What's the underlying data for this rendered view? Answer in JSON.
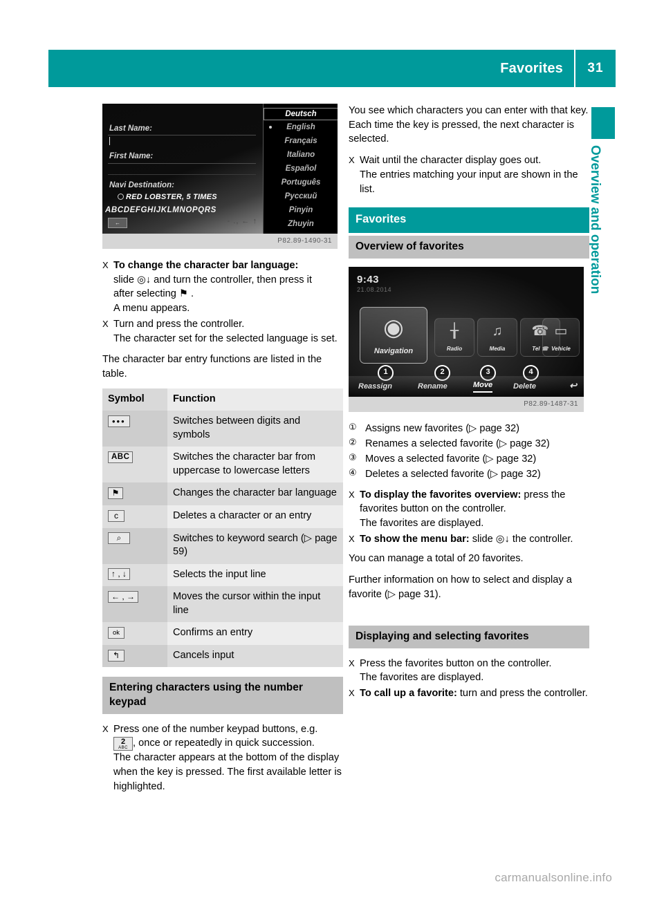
{
  "header": {
    "title": "Favorites",
    "page_number": "31"
  },
  "side_tab": {
    "label": "Overview and operation"
  },
  "footer": {
    "watermark": "carmanualsonline.info"
  },
  "figure_character_entry": {
    "code": "P82.89-1490-31",
    "field_last_name": "Last Name:",
    "field_first_name": "First Name:",
    "field_navi_destination": "Navi Destination:",
    "destination_value": "RED LOBSTER, 5 TIMES",
    "character_bar": "ABCDEFGHIJKLMNOPQRS",
    "back_key": "←",
    "small_glyphs": "- ., ← ↑",
    "languages": [
      "Deutsch",
      "English",
      "Français",
      "Italiano",
      "Español",
      "Português",
      "Русский",
      "Pinyin",
      "Zhuyin"
    ],
    "selected_language": "Deutsch",
    "active_language": "English"
  },
  "figure_favorites": {
    "code": "P82.89-1487-31",
    "time": "9:43",
    "date": "21.08.2014",
    "tiles": [
      {
        "label": "Navigation",
        "glyph": "◉"
      },
      {
        "label": "Radio",
        "glyph": "╁"
      },
      {
        "label": "Media",
        "glyph": "♫"
      },
      {
        "label": "Tel ☎",
        "glyph": "☎"
      },
      {
        "label": "Vehicle",
        "glyph": "▭"
      }
    ],
    "menu_items": [
      {
        "label": "Reassign",
        "active": false
      },
      {
        "label": "Rename",
        "active": false
      },
      {
        "label": "Move",
        "active": true
      },
      {
        "label": "Delete",
        "active": false
      }
    ],
    "back_glyph": "↩",
    "callouts": [
      "1",
      "2",
      "3",
      "4"
    ]
  },
  "left_column": {
    "steps_language": [
      {
        "marker": "X",
        "bold_lead": "To change the character bar language:",
        "lines": [
          "slide ◎↓ and turn the controller, then press it",
          "after selecting ⚑ ."
        ],
        "result": "A menu appears."
      },
      {
        "marker": "X",
        "bold_lead": "",
        "text": "Turn and press the controller.",
        "result": "The character set for the selected language is set."
      }
    ],
    "intro_table": "The character bar entry functions are listed in the table.",
    "table": {
      "headers": [
        "Symbol",
        "Function"
      ],
      "rows": [
        {
          "symbol_type": "dots",
          "symbol_text": "•••",
          "function": "Switches between digits and symbols"
        },
        {
          "symbol_type": "abc",
          "symbol_text": "ABC",
          "function": "Switches the character bar from uppercase to lowercase letters"
        },
        {
          "symbol_type": "flag",
          "symbol_text": "⚑",
          "function": "Changes the character bar language"
        },
        {
          "symbol_type": "plain",
          "symbol_text": "c",
          "function": "Deletes a character or an entry"
        },
        {
          "symbol_type": "search",
          "symbol_text": "⌕",
          "function": "Switches to keyword search (▷ page 59)"
        },
        {
          "symbol_type": "updown",
          "symbol_text": "↑ , ↓",
          "function": "Selects the input line"
        },
        {
          "symbol_type": "leftright",
          "symbol_text": "← , →",
          "function": "Moves the cursor within the input line"
        },
        {
          "symbol_type": "ok",
          "symbol_text": "ok",
          "function": "Confirms an entry"
        },
        {
          "symbol_type": "back",
          "symbol_text": "↰",
          "function": "Cancels input"
        }
      ]
    },
    "heading_keypad": "Entering characters using the number keypad",
    "keypad_step": {
      "marker": "X",
      "line1": "Press one of the number keypad buttons, e.g.",
      "key_number": "2",
      "key_sub": "ABC",
      "line2": ", once or repeatedly in quick succession.",
      "line3": "The character appears at the bottom of the display when the key is pressed. The first available letter is highlighted."
    }
  },
  "right_column": {
    "intro_paragraph": "You see which characters you can enter with that key. Each time the key is pressed, the next character is selected.",
    "step_wait": {
      "marker": "X",
      "text": "Wait until the character display goes out.",
      "result": "The entries matching your input are shown in the list."
    },
    "heading_favorites": "Favorites",
    "heading_overview": "Overview of favorites",
    "legend": [
      {
        "num": "①",
        "text": "Assigns new favorites (▷ page 32)"
      },
      {
        "num": "②",
        "text": "Renames a selected favorite (▷ page 32)"
      },
      {
        "num": "③",
        "text": "Moves a selected favorite (▷ page 32)"
      },
      {
        "num": "④",
        "text": "Deletes a selected favorite (▷ page 32)"
      }
    ],
    "step_display": {
      "marker": "X",
      "bold_lead": "To display the favorites overview:",
      "text": " press the favorites button on the controller.",
      "result": "The favorites are displayed."
    },
    "step_menubar": {
      "marker": "X",
      "bold_lead": "To show the menu bar:",
      "text": " slide ◎↓ the controller."
    },
    "paragraph_total": "You can manage a total of 20 favorites.",
    "paragraph_further": "Further information on how to select and display a favorite (▷ page 31).",
    "heading_displaying": "Displaying and selecting favorites",
    "step_press": {
      "marker": "X",
      "text": "Press the favorites button on the controller.",
      "result": "The favorites are displayed."
    },
    "step_callup": {
      "marker": "X",
      "bold_lead": "To call up a favorite:",
      "text": " turn and press the controller."
    }
  }
}
